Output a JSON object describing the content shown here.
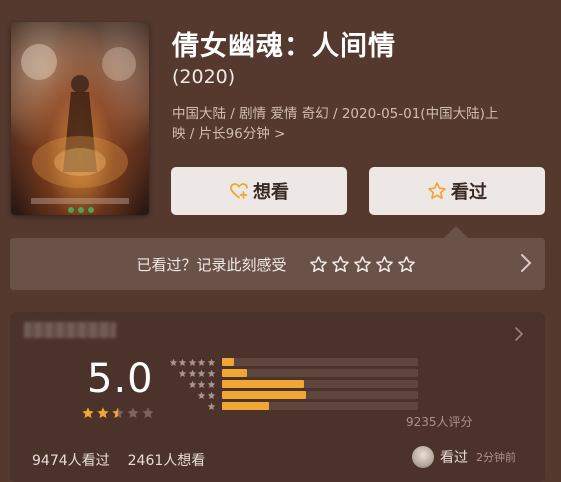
{
  "movie": {
    "title": "倩女幽魂：人间情",
    "year": "(2020)",
    "info_line1": "中国大陆 / 剧情 爱情 奇幻 / 2020-05-01(中国大陆)上",
    "info_line2": "映 / 片长96分钟",
    "info_chevron": ">"
  },
  "actions": {
    "want_label": "想看",
    "seen_label": "看过"
  },
  "rate_prompt": {
    "text": "已看过？记录此刻感受",
    "star_count": 5
  },
  "rating": {
    "score": "5.0",
    "stars_filled": 2.5,
    "stars_total": 5,
    "distribution": [
      {
        "stars": 5,
        "fraction": 0.06
      },
      {
        "stars": 4,
        "fraction": 0.13
      },
      {
        "stars": 3,
        "fraction": 0.42
      },
      {
        "stars": 2,
        "fraction": 0.43
      },
      {
        "stars": 1,
        "fraction": 0.24
      }
    ],
    "count_text": "9235人评分"
  },
  "footer": {
    "seen_count": "9474人看过",
    "want_count": "2461人想看",
    "user_action": "看过",
    "user_time": "2分钟前"
  },
  "colors": {
    "background": "#55392f",
    "accent": "#f0a634",
    "button_bg": "#ede8e6"
  }
}
